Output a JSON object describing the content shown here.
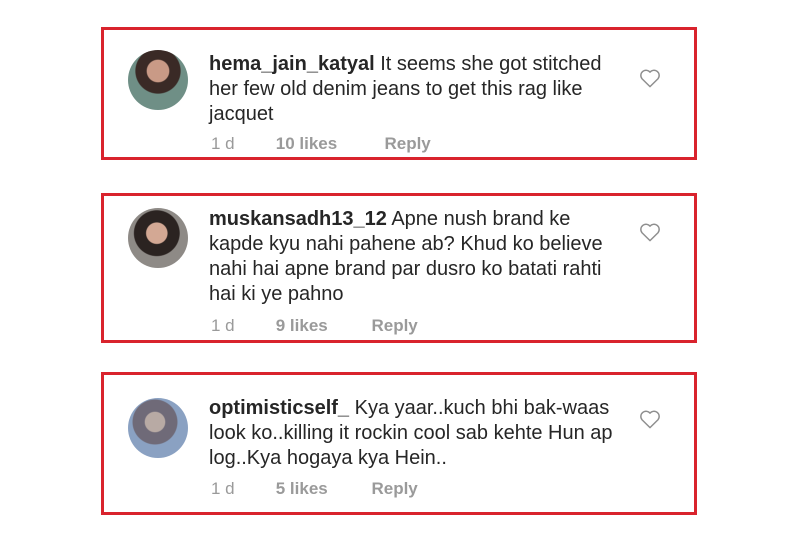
{
  "comments": [
    {
      "username": "hema_jain_katyal",
      "text": "It seems she got stitched her  few old denim jeans to get this rag like jacquet",
      "time": "1 d",
      "likes": "10 likes",
      "reply": "Reply",
      "like_icon": "heart-outline-icon"
    },
    {
      "username": "muskansadh13_12",
      "text": "Apne nush brand ke kapde kyu nahi pahene ab? Khud ko believe nahi hai apne brand par dusro ko batati rahti hai ki ye pahno",
      "time": "1 d",
      "likes": "9 likes",
      "reply": "Reply",
      "like_icon": "heart-outline-icon"
    },
    {
      "username": "optimisticself_",
      "text": "Kya yaar..kuch bhi bak-waas look ko..killing it rockin cool sab kehte Hun ap log..Kya hogaya kya Hein..",
      "time": "1 d",
      "likes": "5 likes",
      "reply": "Reply",
      "like_icon": "heart-outline-icon"
    }
  ],
  "colors": {
    "highlight_border": "#d9232d",
    "text": "#262626",
    "meta": "#9a9a9a"
  }
}
